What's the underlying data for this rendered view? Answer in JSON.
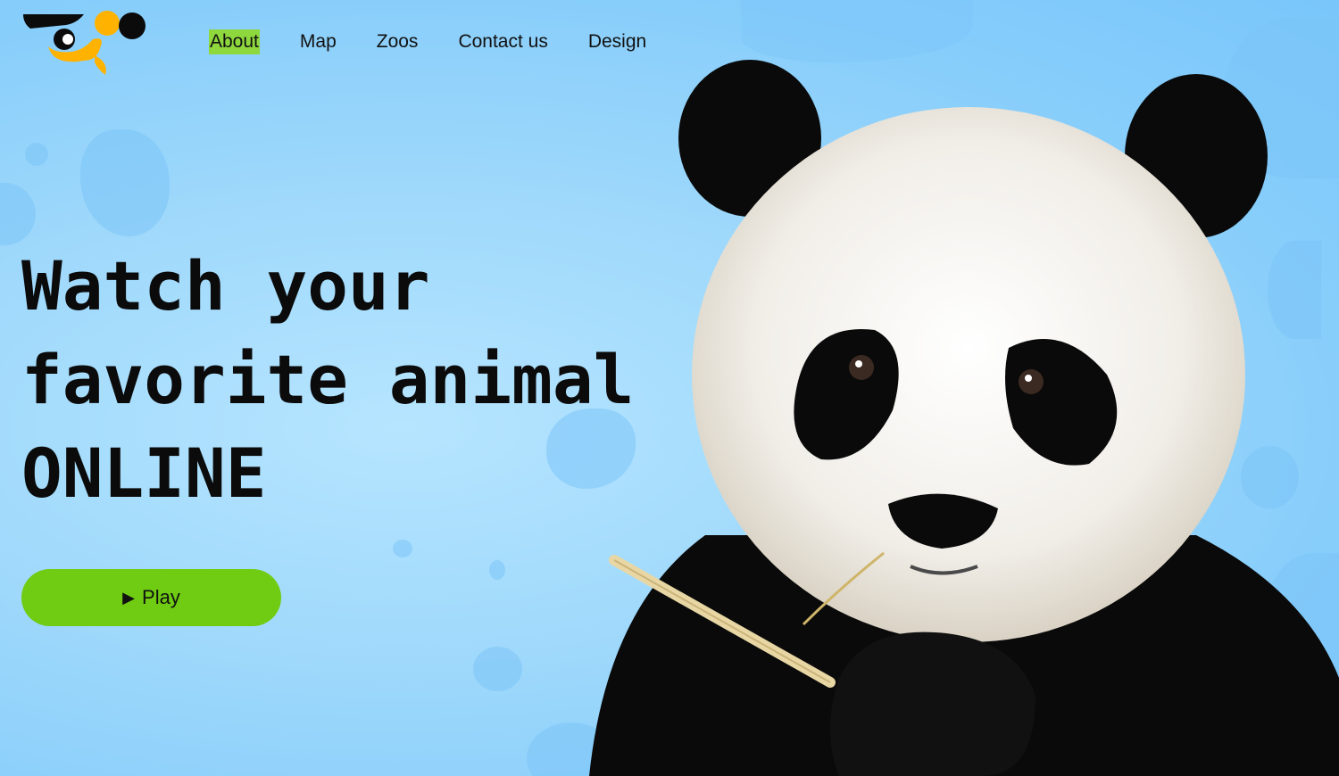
{
  "nav": {
    "items": [
      {
        "label": "About",
        "active": true
      },
      {
        "label": "Map",
        "active": false
      },
      {
        "label": "Zoos",
        "active": false
      },
      {
        "label": "Contact us",
        "active": false
      },
      {
        "label": "Design",
        "active": false
      }
    ]
  },
  "hero": {
    "title_lines": [
      "Watch your",
      "favorite animal",
      "ONLINE"
    ],
    "play_label": "Play",
    "play_icon": "play-triangle-icon"
  },
  "colors": {
    "background": "#9ed8fb",
    "active_nav_highlight": "#8ed83d",
    "play_button": "#6fcc12",
    "logo_yellow": "#ffb300",
    "text": "#0b0b0b"
  }
}
